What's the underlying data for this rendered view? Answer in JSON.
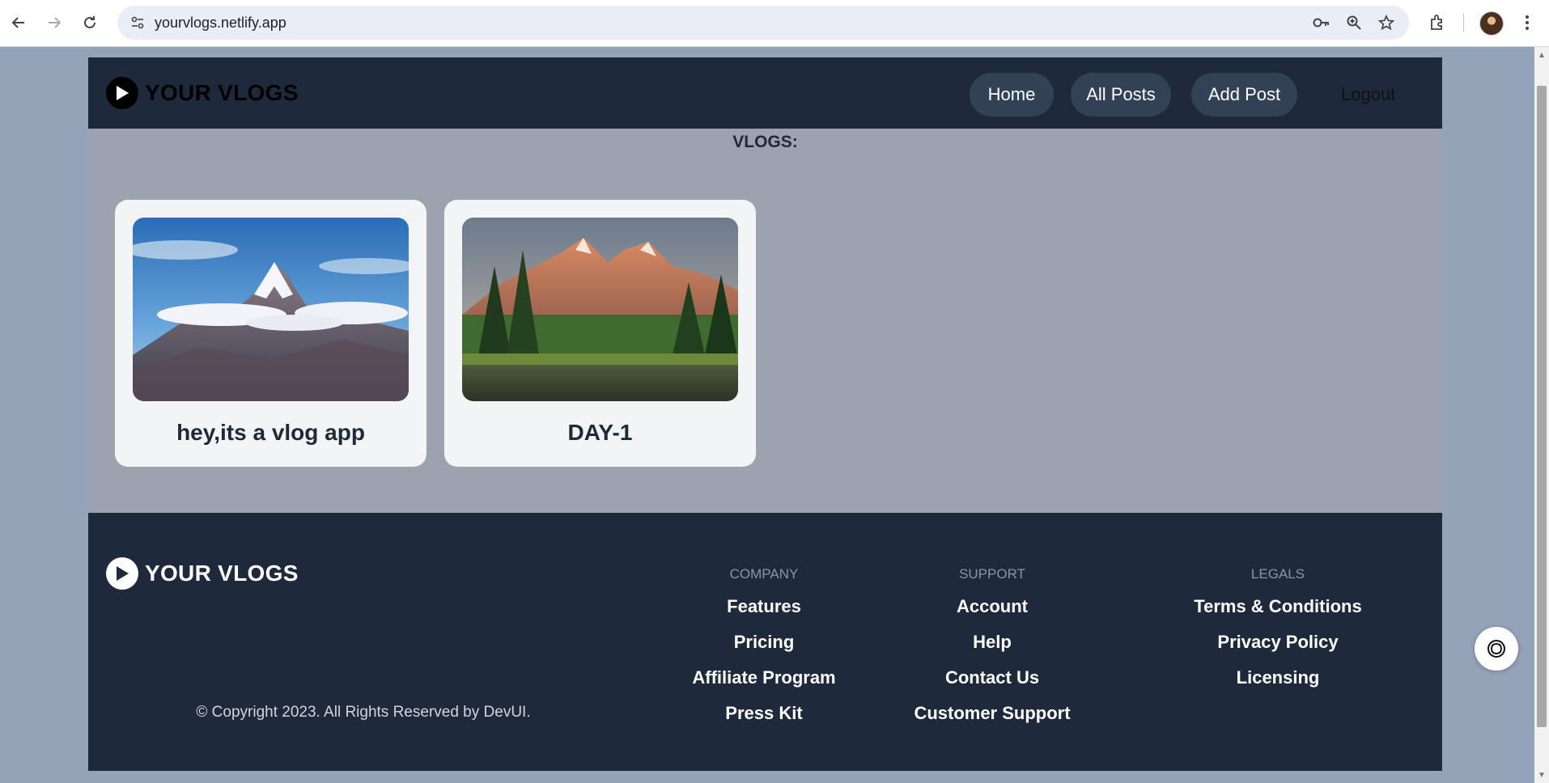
{
  "browser": {
    "url": "yourvlogs.netlify.app",
    "icons": [
      "back-icon",
      "forward-icon",
      "reload-icon",
      "site-info-icon",
      "key-icon",
      "zoom-icon",
      "star-icon",
      "extensions-icon",
      "menu-icon"
    ]
  },
  "header": {
    "logo_text": "YOUR VLOGS",
    "nav": {
      "home": "Home",
      "all_posts": "All Posts",
      "add_post": "Add Post",
      "logout": "Logout"
    }
  },
  "main": {
    "section_title": "VLOGS:",
    "posts": [
      {
        "title": "hey,its a vlog app",
        "image": "snowy-mountain-peak"
      },
      {
        "title": "DAY-1",
        "image": "mountain-forest-lake"
      }
    ]
  },
  "footer": {
    "logo_text": "YOUR VLOGS",
    "copyright": "© Copyright 2023. All Rights Reserved by DevUI.",
    "columns": [
      {
        "heading": "COMPANY",
        "links": [
          "Features",
          "Pricing",
          "Affiliate Program",
          "Press Kit"
        ]
      },
      {
        "heading": "SUPPORT",
        "links": [
          "Account",
          "Help",
          "Contact Us",
          "Customer Support"
        ]
      },
      {
        "heading": "LEGALS",
        "links": [
          "Terms & Conditions",
          "Privacy Policy",
          "Licensing"
        ]
      }
    ]
  },
  "colors": {
    "page_bg": "#94a3b8",
    "header_bg": "#1e293b",
    "pill_bg": "#334155",
    "main_bg": "#9ca3af",
    "card_bg": "#f3f4f6"
  }
}
